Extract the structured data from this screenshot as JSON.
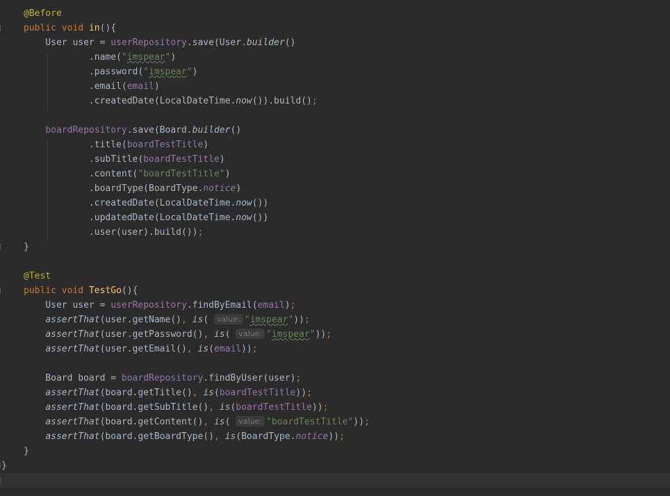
{
  "editor": {
    "lines": [
      {
        "tokens": [
          {
            "t": "@Before",
            "c": "ann"
          }
        ]
      },
      {
        "tokens": [
          {
            "t": "public",
            "c": "kw"
          },
          {
            "t": " "
          },
          {
            "t": "void",
            "c": "kw"
          },
          {
            "t": " "
          },
          {
            "t": "in",
            "c": "fn"
          },
          {
            "t": "(){"
          }
        ]
      },
      {
        "tokens": [
          {
            "t": "    User user = "
          },
          {
            "t": "userRepository",
            "c": "field"
          },
          {
            "t": ".save(User."
          },
          {
            "t": "builder",
            "c": "ital"
          },
          {
            "t": "()"
          }
        ]
      },
      {
        "tokens": [
          {
            "t": "            .name("
          },
          {
            "t": "\"",
            "c": "str"
          },
          {
            "t": "imspear",
            "c": "str typo"
          },
          {
            "t": "\"",
            "c": "str"
          },
          {
            "t": ")"
          }
        ]
      },
      {
        "tokens": [
          {
            "t": "            .password("
          },
          {
            "t": "\"",
            "c": "str"
          },
          {
            "t": "imspear",
            "c": "str typo"
          },
          {
            "t": "\"",
            "c": "str"
          },
          {
            "t": ")"
          }
        ]
      },
      {
        "tokens": [
          {
            "t": "            .email("
          },
          {
            "t": "email",
            "c": "field"
          },
          {
            "t": ")"
          }
        ]
      },
      {
        "tokens": [
          {
            "t": "            .createdDate(LocalDateTime."
          },
          {
            "t": "now",
            "c": "ital"
          },
          {
            "t": "()).build()"
          },
          {
            "t": ";",
            "c": "kw"
          }
        ]
      },
      {
        "tokens": []
      },
      {
        "tokens": [
          {
            "t": "    "
          },
          {
            "t": "boardRepository",
            "c": "field"
          },
          {
            "t": ".save(Board."
          },
          {
            "t": "builder",
            "c": "ital"
          },
          {
            "t": "()"
          }
        ]
      },
      {
        "tokens": [
          {
            "t": "            .title("
          },
          {
            "t": "boardTestTitle",
            "c": "field"
          },
          {
            "t": ")"
          }
        ]
      },
      {
        "tokens": [
          {
            "t": "            .subTitle("
          },
          {
            "t": "boardTestTitle",
            "c": "field"
          },
          {
            "t": ")"
          }
        ]
      },
      {
        "tokens": [
          {
            "t": "            .content("
          },
          {
            "t": "\"boardTestTitle\"",
            "c": "str"
          },
          {
            "t": ")"
          }
        ]
      },
      {
        "tokens": [
          {
            "t": "            .boardType(BoardType."
          },
          {
            "t": "notice",
            "c": "field-it"
          },
          {
            "t": ")"
          }
        ]
      },
      {
        "tokens": [
          {
            "t": "            .createdDate(LocalDateTime."
          },
          {
            "t": "now",
            "c": "ital"
          },
          {
            "t": "())"
          }
        ]
      },
      {
        "tokens": [
          {
            "t": "            .updatedDate(LocalDateTime."
          },
          {
            "t": "now",
            "c": "ital"
          },
          {
            "t": "())"
          }
        ]
      },
      {
        "tokens": [
          {
            "t": "            .user(user).build())"
          },
          {
            "t": ";",
            "c": "kw"
          }
        ]
      },
      {
        "tokens": [
          {
            "t": "}"
          }
        ]
      },
      {
        "tokens": []
      },
      {
        "tokens": [
          {
            "t": "@Test",
            "c": "ann"
          }
        ]
      },
      {
        "tokens": [
          {
            "t": "public",
            "c": "kw"
          },
          {
            "t": " "
          },
          {
            "t": "void",
            "c": "kw"
          },
          {
            "t": " "
          },
          {
            "t": "TestGo",
            "c": "fn"
          },
          {
            "t": "(){"
          }
        ]
      },
      {
        "tokens": [
          {
            "t": "    User user = "
          },
          {
            "t": "userRepository",
            "c": "field"
          },
          {
            "t": ".findByEmail("
          },
          {
            "t": "email",
            "c": "field"
          },
          {
            "t": ")"
          },
          {
            "t": ";",
            "c": "kw"
          }
        ]
      },
      {
        "tokens": [
          {
            "t": "    "
          },
          {
            "t": "assertThat",
            "c": "ital"
          },
          {
            "t": "(user.getName()"
          },
          {
            "t": ",",
            "c": "kw"
          },
          {
            "t": " "
          },
          {
            "t": "is",
            "c": "ital"
          },
          {
            "t": "( "
          },
          {
            "t": "value:",
            "c": "hint"
          },
          {
            "t": "\"",
            "c": "str"
          },
          {
            "t": "imspear",
            "c": "str typo"
          },
          {
            "t": "\"",
            "c": "str"
          },
          {
            "t": "))"
          },
          {
            "t": ";",
            "c": "kw"
          }
        ]
      },
      {
        "tokens": [
          {
            "t": "    "
          },
          {
            "t": "assertThat",
            "c": "ital"
          },
          {
            "t": "(user.getPassword()"
          },
          {
            "t": ",",
            "c": "kw"
          },
          {
            "t": " "
          },
          {
            "t": "is",
            "c": "ital"
          },
          {
            "t": "( "
          },
          {
            "t": "value:",
            "c": "hint"
          },
          {
            "t": "\"",
            "c": "str"
          },
          {
            "t": "imspear",
            "c": "str typo"
          },
          {
            "t": "\"",
            "c": "str"
          },
          {
            "t": "))"
          },
          {
            "t": ";",
            "c": "kw"
          }
        ]
      },
      {
        "tokens": [
          {
            "t": "    "
          },
          {
            "t": "assertThat",
            "c": "ital"
          },
          {
            "t": "(user.getEmail()"
          },
          {
            "t": ",",
            "c": "kw"
          },
          {
            "t": " "
          },
          {
            "t": "is",
            "c": "ital"
          },
          {
            "t": "("
          },
          {
            "t": "email",
            "c": "field"
          },
          {
            "t": "))"
          },
          {
            "t": ";",
            "c": "kw"
          }
        ]
      },
      {
        "tokens": []
      },
      {
        "tokens": [
          {
            "t": "    Board board = "
          },
          {
            "t": "boardRepository",
            "c": "field"
          },
          {
            "t": ".findByUser(user)"
          },
          {
            "t": ";",
            "c": "kw"
          }
        ]
      },
      {
        "tokens": [
          {
            "t": "    "
          },
          {
            "t": "assertThat",
            "c": "ital"
          },
          {
            "t": "(board.getTitle()"
          },
          {
            "t": ",",
            "c": "kw"
          },
          {
            "t": " "
          },
          {
            "t": "is",
            "c": "ital"
          },
          {
            "t": "("
          },
          {
            "t": "boardTestTitle",
            "c": "field"
          },
          {
            "t": "))"
          },
          {
            "t": ";",
            "c": "kw"
          }
        ]
      },
      {
        "tokens": [
          {
            "t": "    "
          },
          {
            "t": "assertThat",
            "c": "ital"
          },
          {
            "t": "(board.getSubTitle()"
          },
          {
            "t": ",",
            "c": "kw"
          },
          {
            "t": " "
          },
          {
            "t": "is",
            "c": "ital"
          },
          {
            "t": "("
          },
          {
            "t": "boardTestTitle",
            "c": "field"
          },
          {
            "t": "))"
          },
          {
            "t": ";",
            "c": "kw"
          }
        ]
      },
      {
        "tokens": [
          {
            "t": "    "
          },
          {
            "t": "assertThat",
            "c": "ital"
          },
          {
            "t": "(board.getContent()"
          },
          {
            "t": ",",
            "c": "kw"
          },
          {
            "t": " "
          },
          {
            "t": "is",
            "c": "ital"
          },
          {
            "t": "( "
          },
          {
            "t": "value:",
            "c": "hint"
          },
          {
            "t": "\"boardTestTitle\"",
            "c": "str"
          },
          {
            "t": "))"
          },
          {
            "t": ";",
            "c": "kw"
          }
        ]
      },
      {
        "tokens": [
          {
            "t": "    "
          },
          {
            "t": "assertThat",
            "c": "ital"
          },
          {
            "t": "(board.getBoardType()"
          },
          {
            "t": ",",
            "c": "kw"
          },
          {
            "t": " "
          },
          {
            "t": "is",
            "c": "ital"
          },
          {
            "t": "(BoardType."
          },
          {
            "t": "notice",
            "c": "field-it"
          },
          {
            "t": "))"
          },
          {
            "t": ";",
            "c": "kw"
          }
        ]
      },
      {
        "tokens": [
          {
            "t": "}"
          }
        ]
      },
      {
        "tokens": [
          {
            "t": "}"
          }
        ],
        "outdent": true
      },
      {
        "tokens": [],
        "current": true
      }
    ]
  }
}
